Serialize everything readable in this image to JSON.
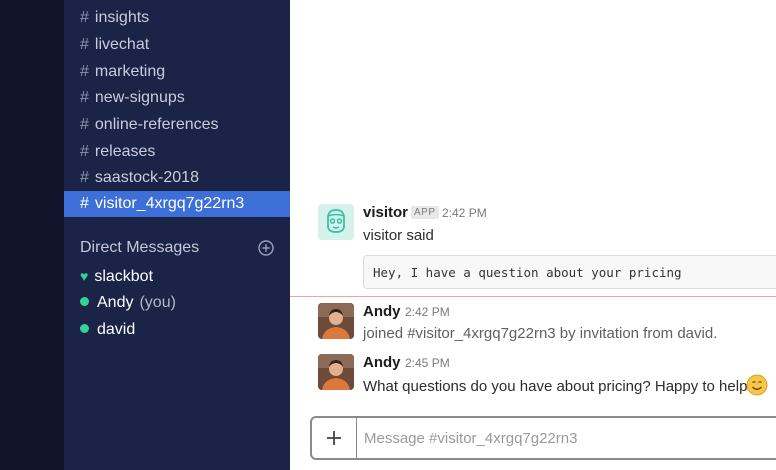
{
  "sidebar": {
    "channels": [
      {
        "name": "insights"
      },
      {
        "name": "livechat"
      },
      {
        "name": "marketing"
      },
      {
        "name": "new-signups"
      },
      {
        "name": "online-references"
      },
      {
        "name": "releases"
      },
      {
        "name": "saastock-2018"
      },
      {
        "name": "visitor_4xrgq7g22rn3",
        "active": true
      }
    ],
    "channel_prefix": "#",
    "dm_header": "Direct Messages",
    "dms": [
      {
        "name": "slackbot",
        "status_icon": "heart-icon"
      },
      {
        "name": "Andy",
        "suffix": "(you)",
        "status_icon": "online-dot-icon"
      },
      {
        "name": "david",
        "status_icon": "online-dot-icon"
      }
    ]
  },
  "messages": [
    {
      "sender": "visitor",
      "badge": "APP",
      "time": "2:42 PM",
      "text": "visitor said",
      "attachment": "Hey, I have a question about your pricing",
      "avatar": "robot-avatar"
    },
    {
      "sender": "Andy",
      "time": "2:42 PM",
      "text": "joined #visitor_4xrgq7g22rn3 by invitation from david.",
      "avatar": "andy-photo-avatar"
    },
    {
      "sender": "Andy",
      "time": "2:45 PM",
      "text": "What questions do you have about pricing? Happy to help",
      "emoji": "smiling-face-emoji",
      "avatar": "andy-photo-avatar"
    }
  ],
  "composer": {
    "placeholder": "Message #visitor_4xrgq7g22rn3",
    "add_icon": "plus-icon"
  },
  "colors": {
    "sidebar_bg": "#1b2347",
    "rail_bg": "#11142a",
    "active_channel": "#3c6fd8",
    "presence": "#2fd49a",
    "new_divider": "#e8a8ab"
  }
}
